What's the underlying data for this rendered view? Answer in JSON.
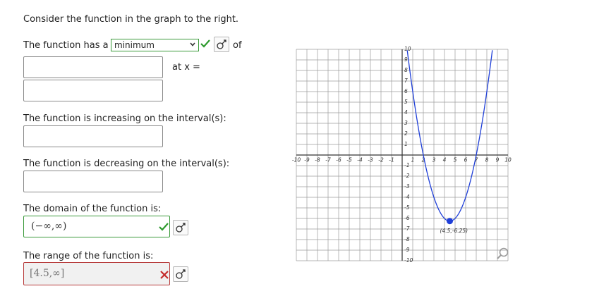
{
  "intro": "Consider the function in the graph to the right.",
  "extremum": {
    "prefix": "The function has a",
    "selected": "minimum",
    "suffix": "of",
    "at_x_label": "at x ="
  },
  "increasing_label": "The function is increasing on the interval(s):",
  "decreasing_label": "The function is decreasing on the interval(s):",
  "domain": {
    "label": "The domain of the function is:",
    "value": "(−∞,∞)",
    "status": "correct"
  },
  "range": {
    "label": "The range of the function is:",
    "value": "[4.5,∞]",
    "status": "incorrect"
  },
  "icons": {
    "dropdown": "chevron-down-icon",
    "correct": "check-icon",
    "incorrect": "x-icon",
    "tool": "sigma-tool-icon",
    "zoom": "magnifier-icon"
  },
  "colors": {
    "correct": "#2e9a2e",
    "incorrect": "#c42b2b",
    "curve": "#1f3fd8"
  },
  "chart_data": {
    "type": "line",
    "title": "",
    "xlabel": "",
    "ylabel": "",
    "xlim": [
      -10,
      10
    ],
    "ylim": [
      -10,
      10
    ],
    "grid": true,
    "x_ticks": [
      "-10",
      "-9",
      "-8",
      "-7",
      "-6",
      "-5",
      "-4",
      "-3",
      "-2",
      "-1",
      "1",
      "2",
      "3",
      "4",
      "5",
      "6",
      "7",
      "8",
      "9",
      "10"
    ],
    "y_ticks": [
      "10",
      "9",
      "8",
      "7",
      "6",
      "5",
      "4",
      "3",
      "2",
      "1",
      "-1",
      "-2",
      "-3",
      "-4",
      "-5",
      "-6",
      "-7",
      "-8",
      "-9",
      "-10"
    ],
    "series": [
      {
        "vertex": [
          4.5,
          -6.25
        ],
        "a": 1,
        "function": "y = (x-2)(x-7)"
      }
    ],
    "point": {
      "x": 4.5,
      "y": -6.25,
      "label": "(4.5,-6.25)"
    }
  }
}
